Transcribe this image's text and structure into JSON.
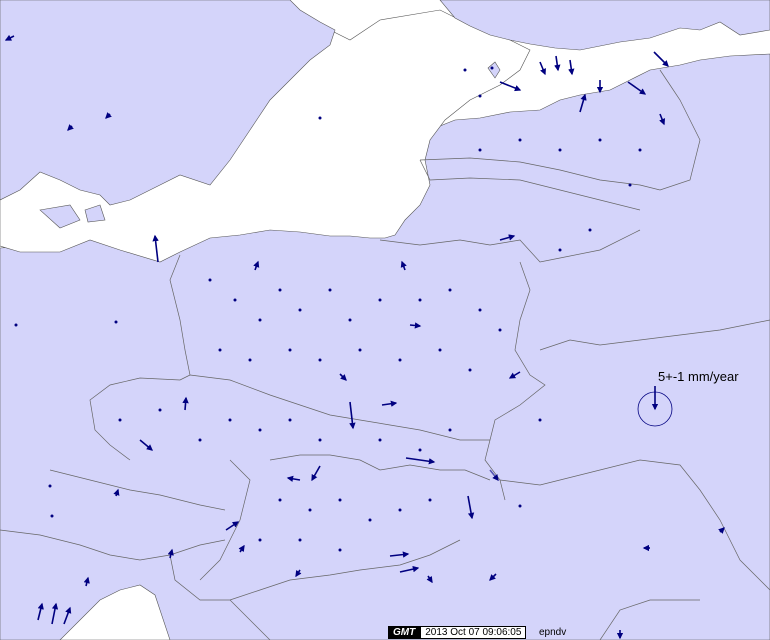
{
  "colors": {
    "land": "#d4d4fa",
    "water": "#ffffff",
    "border": "#555555",
    "vector": "#000080"
  },
  "legend": {
    "label": "5+-1 mm/year"
  },
  "stamp": {
    "logo": "GMT",
    "timestamp": "2013 Oct 07 09:06:05",
    "label": "epndv"
  }
}
